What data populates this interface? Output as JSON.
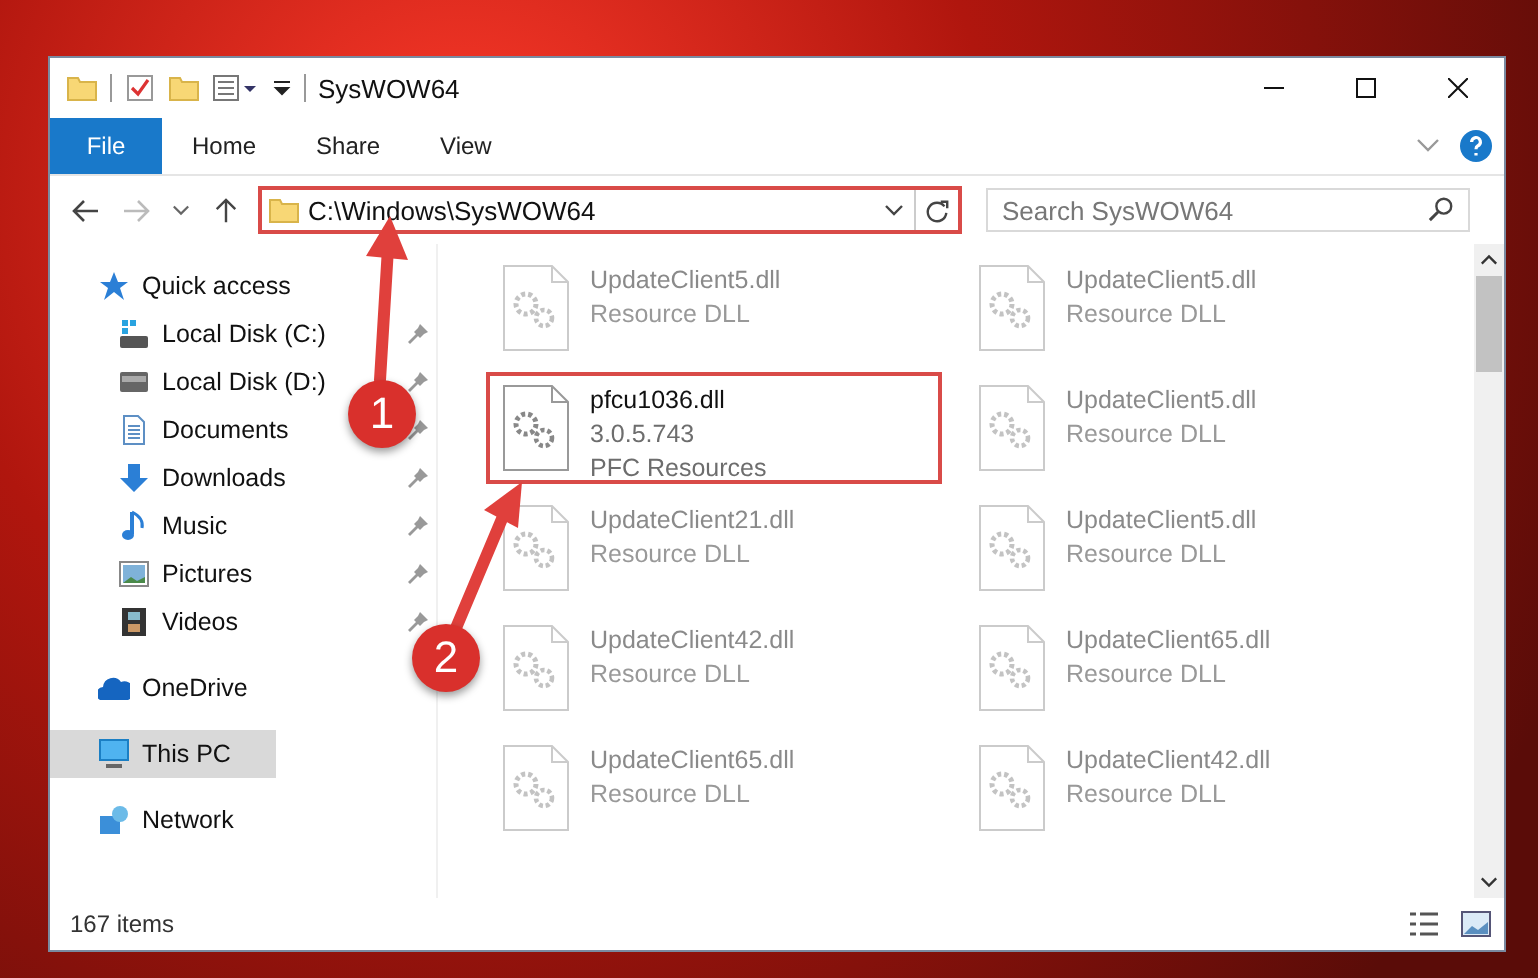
{
  "window": {
    "title": "SysWOW64"
  },
  "ribbon_tabs": [
    {
      "label": "File",
      "kind": "menu"
    },
    {
      "label": "Home",
      "kind": "tab"
    },
    {
      "label": "Share",
      "kind": "tab"
    },
    {
      "label": "View",
      "kind": "tab"
    }
  ],
  "address_bar": {
    "path": "C:\\Windows\\SysWOW64",
    "highlighted": true
  },
  "search": {
    "placeholder": "Search SysWOW64"
  },
  "navigation": [
    {
      "label": "Quick access",
      "kind": "star",
      "selected": false,
      "children": [
        {
          "label": "Local Disk (C:)",
          "kind": "system-drive",
          "pinned": true,
          "selected": false
        },
        {
          "label": "Local Disk (D:)",
          "kind": "drive",
          "pinned": true,
          "selected": false
        },
        {
          "label": "Documents",
          "kind": "documents",
          "pinned": true,
          "selected": false
        },
        {
          "label": "Downloads",
          "kind": "downloads",
          "pinned": true,
          "selected": false
        },
        {
          "label": "Music",
          "kind": "music",
          "pinned": true,
          "selected": false
        },
        {
          "label": "Pictures",
          "kind": "pictures",
          "pinned": true,
          "selected": false
        },
        {
          "label": "Videos",
          "kind": "videos",
          "pinned": true,
          "selected": false
        }
      ]
    },
    {
      "label": "OneDrive",
      "kind": "cloud",
      "selected": false
    },
    {
      "label": "This PC",
      "kind": "pc",
      "selected": true
    },
    {
      "label": "Network",
      "kind": "network",
      "selected": false
    }
  ],
  "files": [
    {
      "name": "UpdateClient5.dll",
      "details": [
        "Resource DLL"
      ],
      "faded": true,
      "highlighted": false
    },
    {
      "name": "UpdateClient5.dll",
      "details": [
        "Resource DLL"
      ],
      "faded": true,
      "highlighted": false
    },
    {
      "name": "pfcu1036.dll",
      "details": [
        "3.0.5.743",
        "PFC Resources"
      ],
      "faded": false,
      "highlighted": true
    },
    {
      "name": "UpdateClient5.dll",
      "details": [
        "Resource DLL"
      ],
      "faded": true,
      "highlighted": false
    },
    {
      "name": "UpdateClient21.dll",
      "details": [
        "Resource DLL"
      ],
      "faded": true,
      "highlighted": false
    },
    {
      "name": "UpdateClient5.dll",
      "details": [
        "Resource DLL"
      ],
      "faded": true,
      "highlighted": false
    },
    {
      "name": "UpdateClient42.dll",
      "details": [
        "Resource DLL"
      ],
      "faded": true,
      "highlighted": false
    },
    {
      "name": "UpdateClient65.dll",
      "details": [
        "Resource DLL"
      ],
      "faded": true,
      "highlighted": false
    },
    {
      "name": "UpdateClient65.dll",
      "details": [
        "Resource DLL"
      ],
      "faded": true,
      "highlighted": false
    },
    {
      "name": "UpdateClient42.dll",
      "details": [
        "Resource DLL"
      ],
      "faded": true,
      "highlighted": false
    }
  ],
  "status_bar": {
    "item_count": "167 items"
  },
  "callouts": [
    {
      "number": "1"
    },
    {
      "number": "2"
    }
  ]
}
